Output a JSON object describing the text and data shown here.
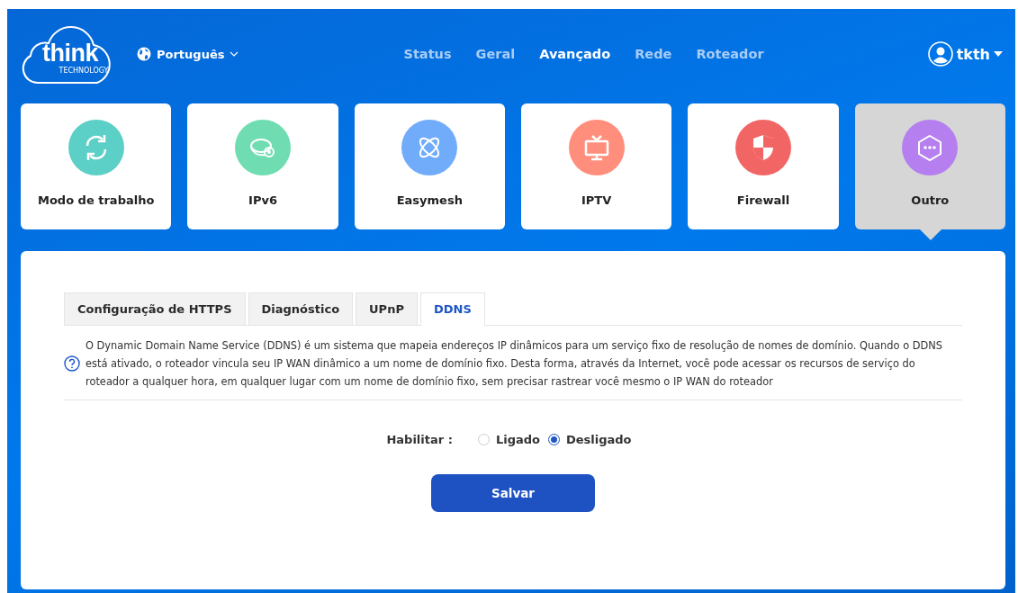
{
  "logo": {
    "name": "think",
    "tagline": "TECHNOLOGY"
  },
  "language": {
    "label": "Português"
  },
  "nav": [
    {
      "label": "Status",
      "selected": false
    },
    {
      "label": "Geral",
      "selected": false
    },
    {
      "label": "Avançado",
      "selected": true
    },
    {
      "label": "Rede",
      "selected": false
    },
    {
      "label": "Roteador",
      "selected": false
    }
  ],
  "user": {
    "name": "tkth"
  },
  "cards": [
    {
      "label": "Modo de trabalho",
      "kind": "refresh",
      "color": "#5ccfc6",
      "selected": false
    },
    {
      "label": "IPv6",
      "kind": "ipv6",
      "color": "#6fdcb2",
      "selected": false
    },
    {
      "label": "Easymesh",
      "kind": "mesh",
      "color": "#70acfa",
      "selected": false
    },
    {
      "label": "IPTV",
      "kind": "tv",
      "color": "#ff8f7c",
      "selected": false
    },
    {
      "label": "Firewall",
      "kind": "shield",
      "color": "#f26565",
      "selected": false
    },
    {
      "label": "Outro",
      "kind": "more",
      "color": "#b57ff0",
      "selected": true
    }
  ],
  "tabs": [
    {
      "label": "Configuração de HTTPS",
      "selected": false
    },
    {
      "label": "Diagnóstico",
      "selected": false
    },
    {
      "label": "UPnP",
      "selected": false
    },
    {
      "label": "DDNS",
      "selected": true
    }
  ],
  "info": "O Dynamic Domain Name Service (DDNS) é um sistema que mapeia endereços IP dinâmicos para um serviço fixo de resolução de nomes de domínio. Quando o DDNS está ativado, o roteador vincula seu IP WAN dinâmico a um nome de domínio fixo. Desta forma, através da Internet, você pode acessar os recursos de serviço do roteador a qualquer hora, em qualquer lugar com um nome de domínio fixo, sem precisar rastrear você mesmo o IP WAN do roteador",
  "enable": {
    "label": "Habilitar",
    "separator": ":",
    "options": [
      {
        "label": "Ligado",
        "selected": false
      },
      {
        "label": "Desligado",
        "selected": true
      }
    ]
  },
  "save_button": "Salvar"
}
